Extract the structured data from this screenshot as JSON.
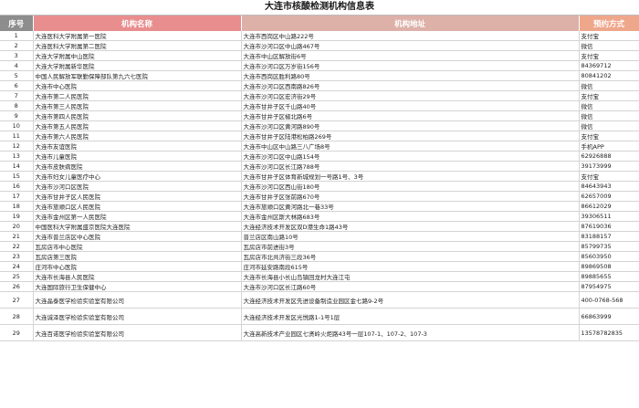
{
  "title": "大连市核酸检测机构信息表",
  "headers": {
    "no": "序号",
    "name": "机构名称",
    "address": "机构地址",
    "booking": "预约方式"
  },
  "rows": [
    {
      "no": "1",
      "name": "大连医科大学附属第一医院",
      "address": "大连市西岗区中山路222号",
      "booking": "支付宝"
    },
    {
      "no": "2",
      "name": "大连医科大学附属第二医院",
      "address": "大连市沙河口区中山路467号",
      "booking": "微信"
    },
    {
      "no": "3",
      "name": "大连大学附属中山医院",
      "address": "大连市中山区解放街6号",
      "booking": "支付宝"
    },
    {
      "no": "4",
      "name": "大连大学附属新华医院",
      "address": "大连市沙河口区万岁街156号",
      "booking": "84369712"
    },
    {
      "no": "5",
      "name": "中国人民解放军联勤保障部队第九六七医院",
      "address": "大连市西岗区胜利路80号",
      "booking": "80841202"
    },
    {
      "no": "6",
      "name": "大连市中心医院",
      "address": "大连市沙河口区西南路826号",
      "booking": "微信"
    },
    {
      "no": "7",
      "name": "大连市第二人民医院",
      "address": "大连市沙河口区宏济街29号",
      "booking": "支付宝"
    },
    {
      "no": "8",
      "name": "大连市第三人民医院",
      "address": "大连市甘井子区千山路40号",
      "booking": "微信"
    },
    {
      "no": "9",
      "name": "大连市第四人民医院",
      "address": "大连市甘井子区椒北路6号",
      "booking": "微信"
    },
    {
      "no": "10",
      "name": "大连市第五人民医院",
      "address": "大连市沙河口区黄河路890号",
      "booking": "微信"
    },
    {
      "no": "11",
      "name": "大连市第六人民医院",
      "address": "大连市甘井子区陆港松柏路269号",
      "booking": "支付宝"
    },
    {
      "no": "12",
      "name": "大连市友谊医院",
      "address": "大连市中山区中山路三八广场8号",
      "booking": "手机APP"
    },
    {
      "no": "13",
      "name": "大连市儿童医院",
      "address": "大连市沙河口区中山路154号",
      "booking": "62926888"
    },
    {
      "no": "14",
      "name": "大连市皮肤病医院",
      "address": "大连市沙河口区长江路788号",
      "booking": "39173999"
    },
    {
      "no": "15",
      "name": "大连市妇女儿童医疗中心",
      "address": "大连市甘井子区体育新城规划一号路1号、3号",
      "booking": "支付宝"
    },
    {
      "no": "16",
      "name": "大连市沙河口区医院",
      "address": "大连市沙河口区西山街180号",
      "booking": "84643943"
    },
    {
      "no": "17",
      "name": "大连市甘井子区人民医院",
      "address": "大连市甘井子区张前路670号",
      "booking": "62657009"
    },
    {
      "no": "18",
      "name": "大连市旅顺口区人民医院",
      "address": "大连市旅顺口区黄河路北一巷33号",
      "booking": "86612029"
    },
    {
      "no": "19",
      "name": "大连市金州区第一人民医院",
      "address": "大连市金州区斯大林路683号",
      "booking": "39306511"
    },
    {
      "no": "20",
      "name": "中国医科大学附属盛京医院大连医院",
      "address": "大连经济技术开发区双D港生命1路43号",
      "booking": "87619036"
    },
    {
      "no": "21",
      "name": "大连市普兰店区中心医院",
      "address": "普兰店区南山路10号",
      "booking": "83188157"
    },
    {
      "no": "22",
      "name": "瓦房店市中心医院",
      "address": "瓦房店市前进街3号",
      "booking": "85799735"
    },
    {
      "no": "23",
      "name": "瓦房店第三医院",
      "address": "瓦房店市北共济街三段36号",
      "booking": "85603950"
    },
    {
      "no": "24",
      "name": "庄河市中心医院",
      "address": "庄河市延安路南段615号",
      "booking": "89869508"
    },
    {
      "no": "25",
      "name": "大连市长海县人民医院",
      "address": "大连市长海县小长山岛镇回龙村大连江屯",
      "booking": "89885655"
    },
    {
      "no": "26",
      "name": "大连国际旅行卫生保健中心",
      "address": "大连市沙河口区长江路60号",
      "booking": "87954975"
    },
    {
      "no": "27",
      "name": "大连晶泰医学检验实验室有限公司",
      "address": "大连经济技术开发区先进设备制造业园区金七路9-2号",
      "booking": "400-0768-568"
    },
    {
      "no": "28",
      "name": "大连诚泽医学检验实验室有限公司",
      "address": "大连经济技术开发区光悦路1-1号1层",
      "booking": "66863999"
    },
    {
      "no": "29",
      "name": "大连百诺医学检验实验室有限公司",
      "address": "大连高新技术产业园区七贤岭火炬路43号一层107-1、107-2、107-3",
      "booking": "13578782835"
    }
  ]
}
